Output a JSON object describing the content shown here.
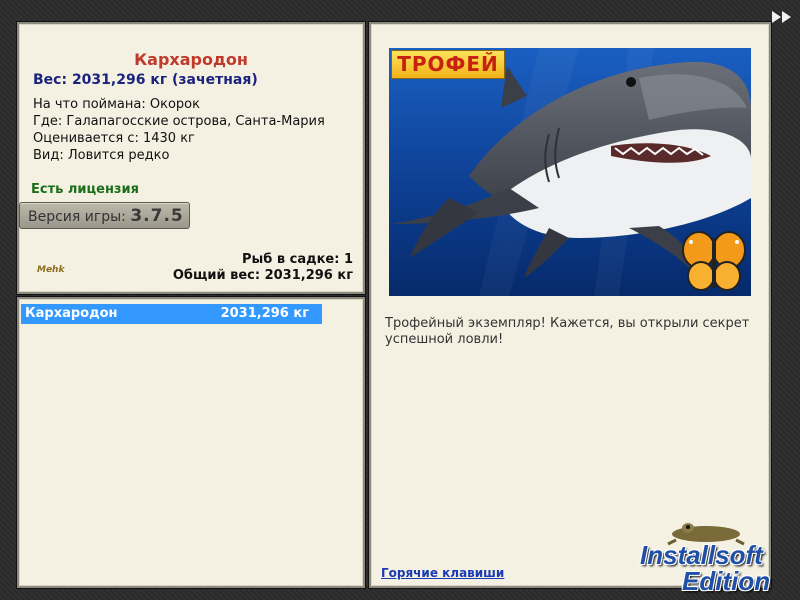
{
  "info": {
    "fish_name": "Кархародон",
    "weight_line": "Вес: 2031,296 кг (зачетная)",
    "bait_line": "На что поймана: Окорок",
    "location_line": "Где: Галапагосские острова, Санта-Мария",
    "rated_line": "Оценивается с: 1430 кг",
    "kind_line": "Вид: Ловится редко",
    "license": "Есть лицензия",
    "version_label": "Версия игры:",
    "version_value": "3.7.5",
    "fish_count": "Рыб в садке: 1",
    "total_weight": "Общий вес: 2031,296 кг",
    "small_logo": "Mehk"
  },
  "catch_list": [
    {
      "name": "Кархародон",
      "weight": "2031,296 кг"
    }
  ],
  "detail": {
    "trophy_label": "ТРОФЕЙ",
    "description": "Трофейный экземпляр! Кажется, вы открыли секрет успешной ловли!",
    "hotkeys_link": "Горячие клавиши"
  },
  "watermark": {
    "line1": "Installsoft",
    "line2": "Edition"
  },
  "icons": {
    "forward": "fast-forward-icon",
    "butterfly": "butterfly-icon",
    "frog": "frog-icon"
  },
  "colors": {
    "panel_bg": "#f4f1e2",
    "fish_name": "#c0392b",
    "weight": "#1a237e",
    "license": "#1b6e1b",
    "selection": "#3399ff",
    "trophy_text": "#c62212"
  }
}
